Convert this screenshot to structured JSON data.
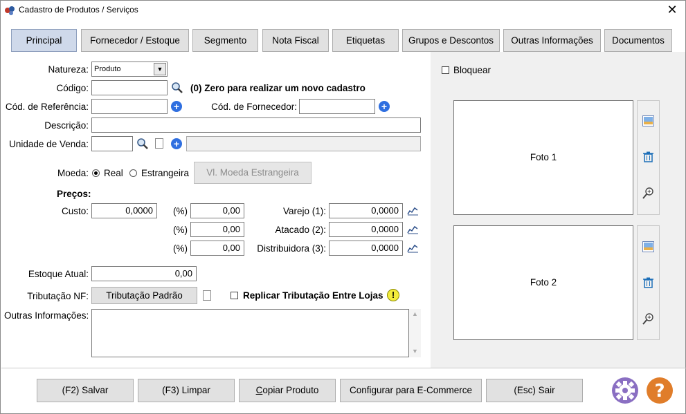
{
  "window": {
    "title": "Cadastro de Produtos / Serviços"
  },
  "tabs": [
    {
      "label": "Principal"
    },
    {
      "label": "Fornecedor / Estoque"
    },
    {
      "label": "Segmento"
    },
    {
      "label": "Nota Fiscal"
    },
    {
      "label": "Etiquetas"
    },
    {
      "label": "Grupos e Descontos"
    },
    {
      "label": "Outras Informações"
    },
    {
      "label": "Documentos"
    }
  ],
  "form": {
    "natureza_label": "Natureza:",
    "natureza_value": "Produto",
    "codigo_label": "Código:",
    "codigo_value": "",
    "codigo_hint": "(0) Zero para realizar um novo cadastro",
    "cod_ref_label": "Cód. de Referência:",
    "cod_ref_value": "",
    "cod_forn_label": "Cód. de Fornecedor:",
    "cod_forn_value": "",
    "descricao_label": "Descrição:",
    "descricao_value": "",
    "unidade_label": "Unidade de Venda:",
    "unidade_value": "",
    "unidade_desc_value": "",
    "moeda_label": "Moeda:",
    "moeda_real": "Real",
    "moeda_estrangeira": "Estrangeira",
    "vl_moeda_button": "Vl. Moeda Estrangeira",
    "precos_label": "Preços:",
    "custo_label": "Custo:",
    "custo_value": "0,0000",
    "pct_label": "(%)",
    "pct_values": [
      "0,00",
      "0,00",
      "0,00"
    ],
    "price_labels": [
      "Varejo (1):",
      "Atacado (2):",
      "Distribuidora (3):"
    ],
    "price_values": [
      "0,0000",
      "0,0000",
      "0,0000"
    ],
    "estoque_label": "Estoque Atual:",
    "estoque_value": "0,00",
    "tributacao_label": "Tributação NF:",
    "tributacao_button": "Tributação Padrão",
    "replicar_label": "Replicar Tributação Entre Lojas",
    "outras_label": "Outras Informações:",
    "outras_value": ""
  },
  "right": {
    "bloquear_label": "Bloquear",
    "foto1": "Foto 1",
    "foto2": "Foto 2"
  },
  "bottom": {
    "salvar": "(F2) Salvar",
    "limpar": "(F3) Limpar",
    "copiar": "Copiar Produto",
    "ecommerce": "Configurar para E-Commerce",
    "sair": "(Esc) Sair"
  },
  "colors": {
    "accent_blue": "#2f6fe0",
    "gear_purple": "#8a6fc2",
    "help_orange": "#e07d2a",
    "warning_yellow": "#f3ec3c"
  }
}
